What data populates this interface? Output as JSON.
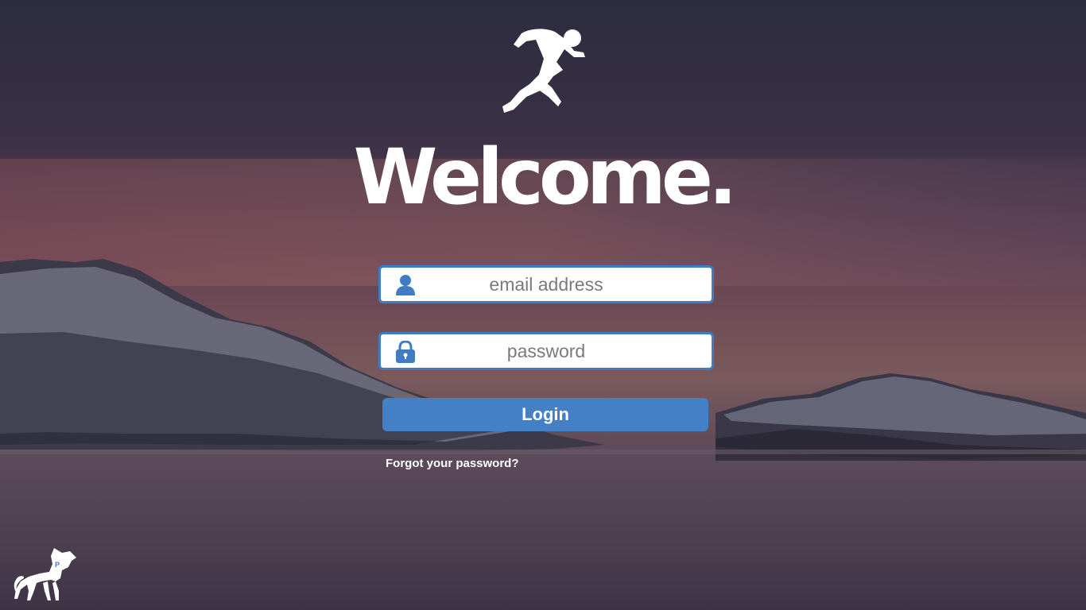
{
  "hero": {
    "title": "Welcome."
  },
  "icons": {
    "logo": "running-man-icon",
    "email": "user-icon",
    "password": "lock-icon",
    "brand": "pony-icon"
  },
  "form": {
    "email_placeholder": "email address",
    "email_value": "",
    "password_placeholder": "password",
    "password_value": "",
    "login_label": "Login",
    "forgot_label": "Forgot your password?"
  },
  "brand": {
    "badge_letter": "P"
  },
  "colors": {
    "accent": "#3f7cc4",
    "button": "#4480c6",
    "text_light": "#ffffff"
  }
}
